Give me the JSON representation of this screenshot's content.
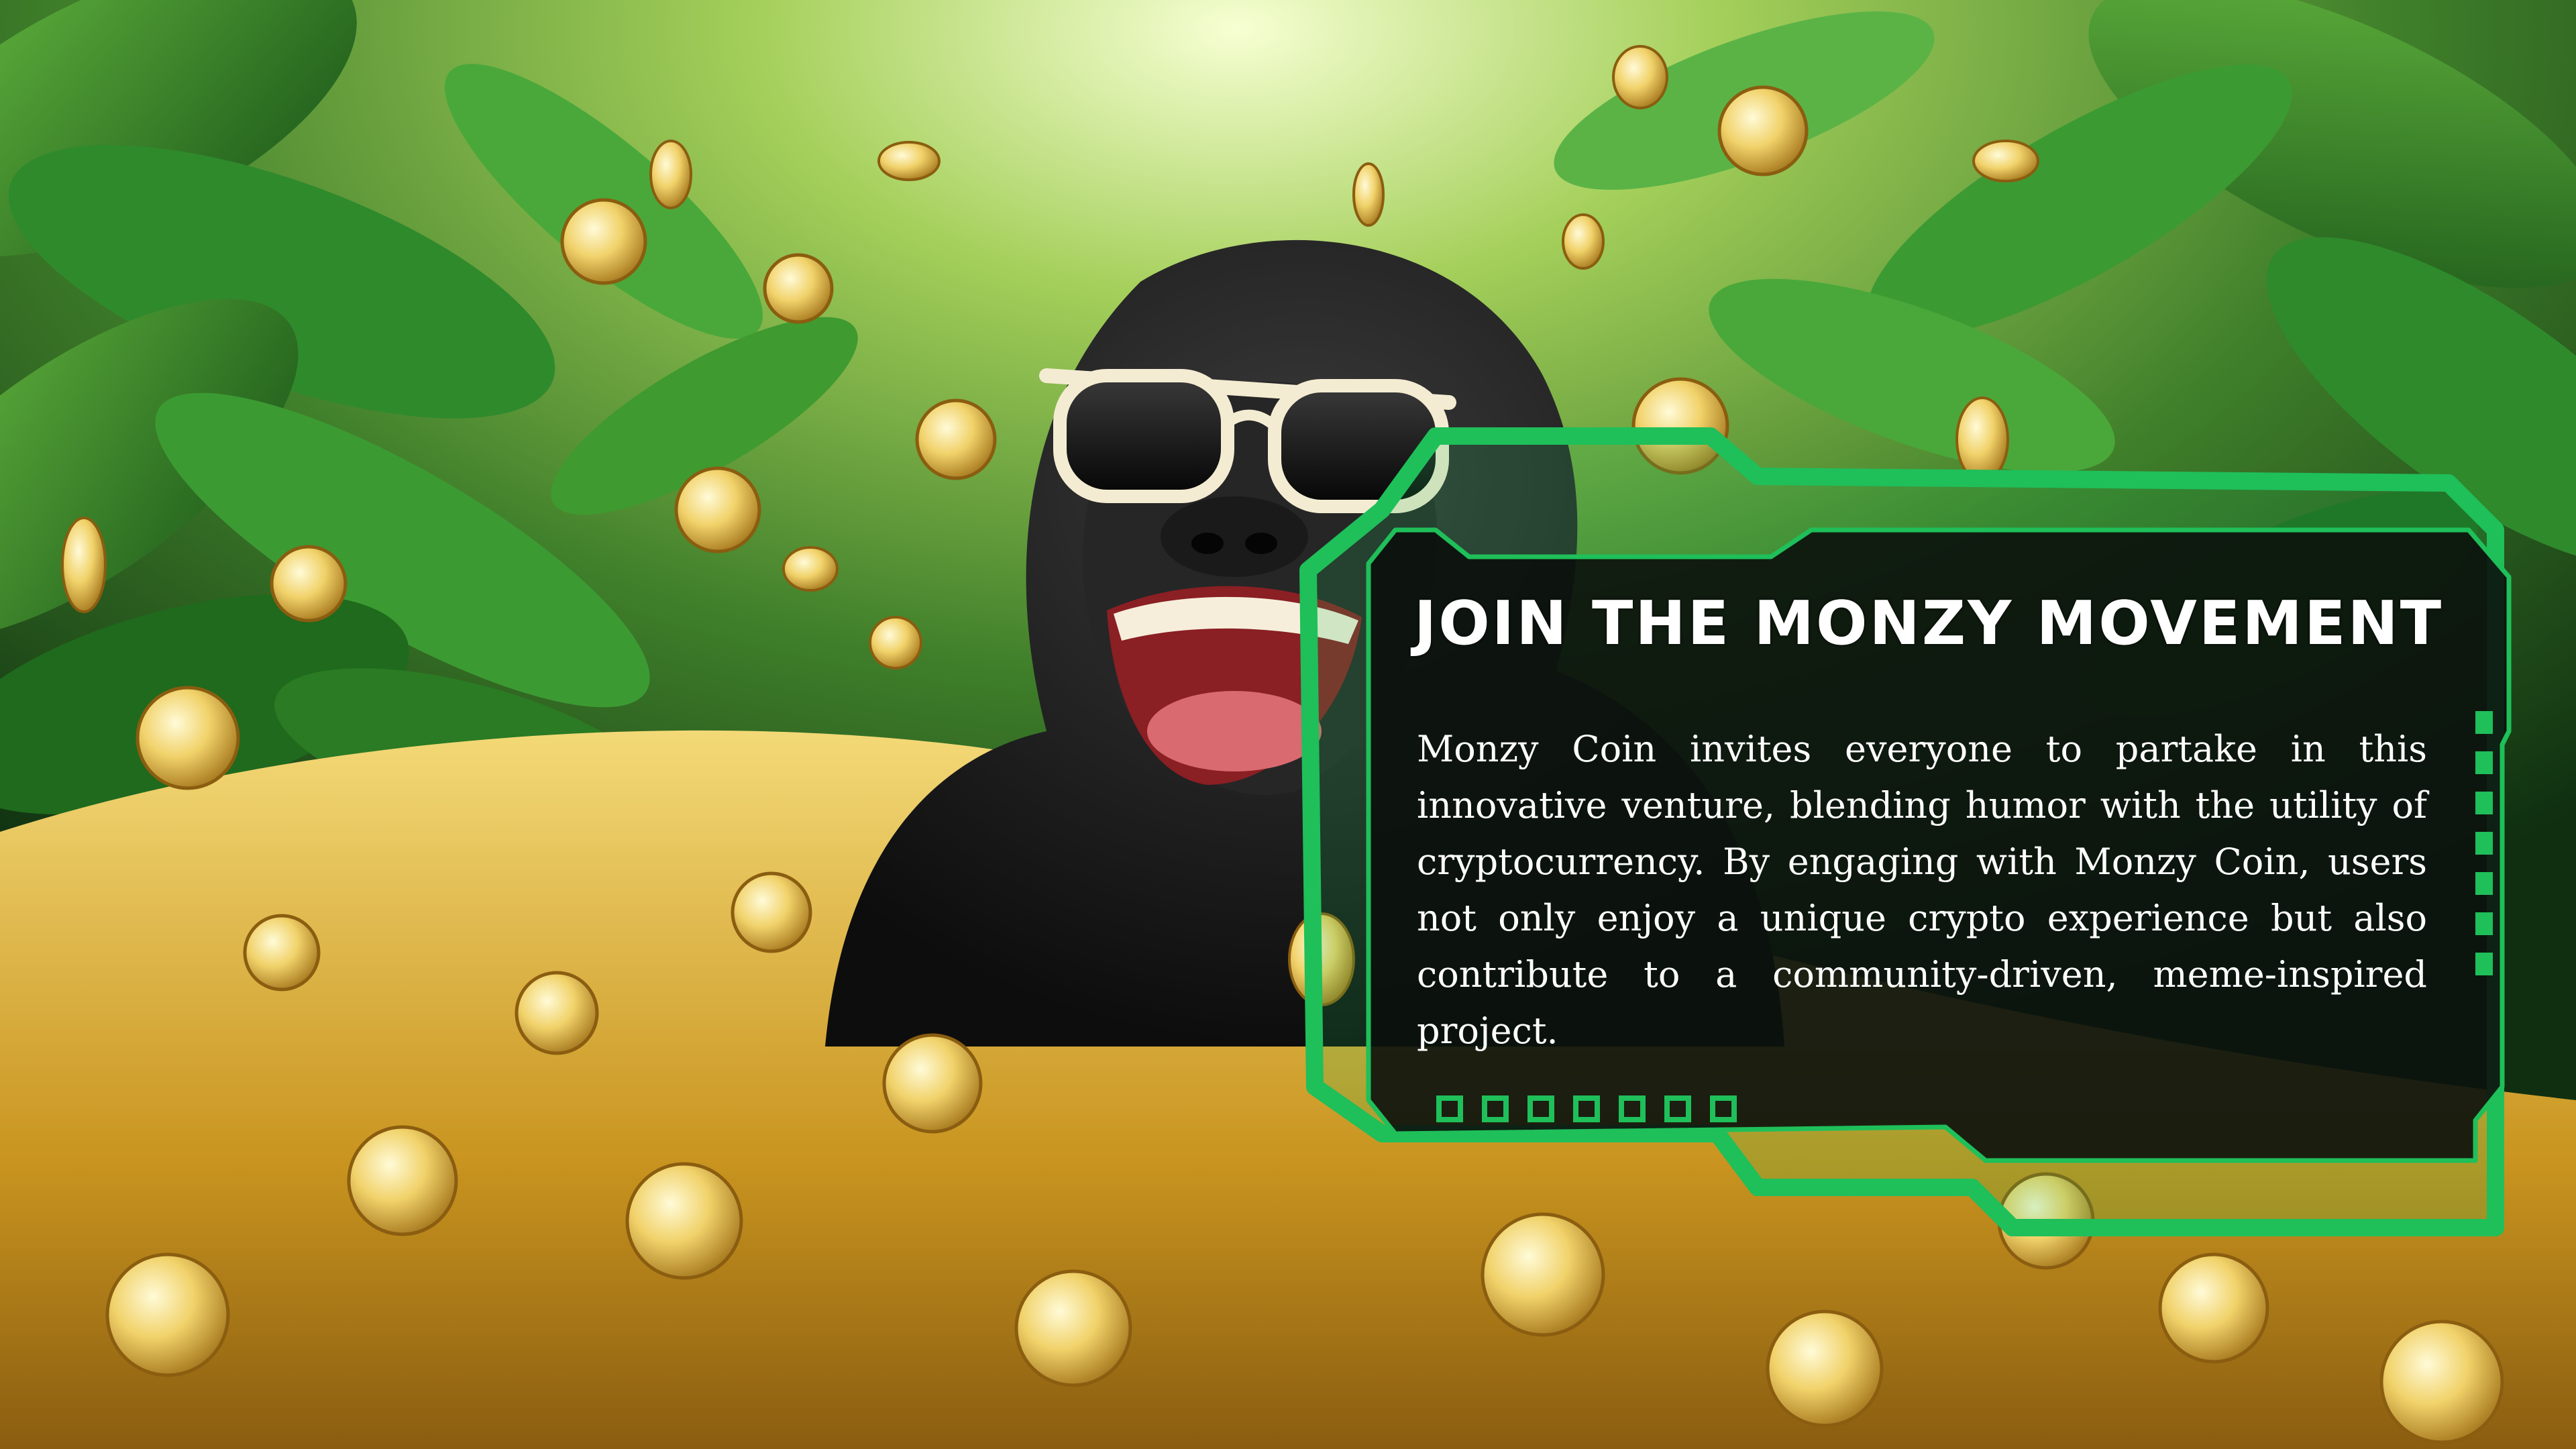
{
  "card": {
    "title": "JOIN THE MONZY MOVEMENT",
    "description": "Monzy Coin invites everyone to partake in this innovative venture, blending humor with the utility of cryptocurrency. By engaging with Monzy Coin, users not only enjoy a unique crypto experience but also contribute to a community-driven, meme-inspired project."
  },
  "colors": {
    "frame_accent": "#1fbf5a",
    "panel_fill": "#0b0f0c",
    "title_text": "#ffffff",
    "coin_gold": "#e8c54a",
    "foliage_green": "#2f8a2c"
  },
  "icons": {
    "mascot": "gorilla-with-sunglasses",
    "coins": "gold-coin"
  }
}
